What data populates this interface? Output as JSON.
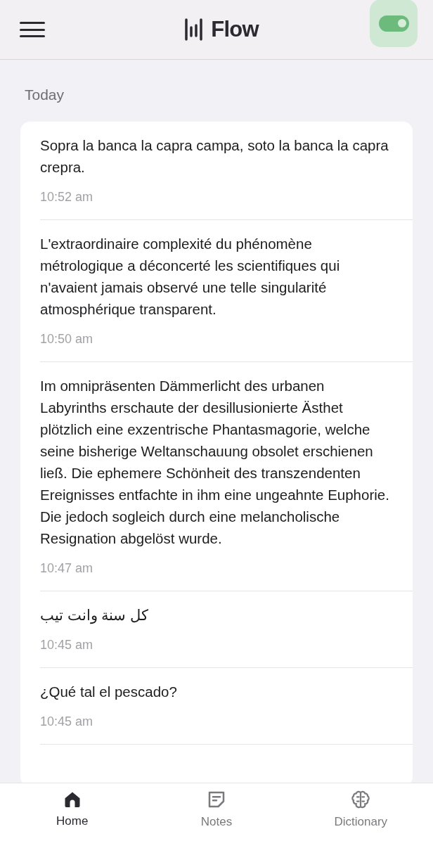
{
  "header": {
    "logo": "Flow",
    "toggle": {
      "on": true
    }
  },
  "section_title": "Today",
  "entries": [
    {
      "text": "Sopra la banca la capra campa, soto la banca la capra crepra.",
      "time": "10:52 am"
    },
    {
      "text": "L'extraordinaire complexité du phénomène métrologique a déconcerté les scientifiques qui n'avaient jamais observé une telle singularité atmosphérique transparent.",
      "time": "10:50 am"
    },
    {
      "text": "Im omnipräsenten Dämmerlicht des urbanen Labyrinths erschaute der desillusionierte Ästhet plötzlich eine exzentrische Phantasmagorie, welche seine bisherige Weltanschauung obsolet erschienen ließ. Die ephemere Schönheit des transzendenten Ereignisses entfachte in ihm eine ungeahnte Euphorie. Die jedoch sogleich durch eine melancholische Resignation abgelöst wurde.",
      "time": "10:47 am"
    },
    {
      "text": "كل سنة وانت تيب",
      "time": "10:45 am"
    },
    {
      "text": "¿Qué tal el pescado?",
      "time": "10:45 am"
    }
  ],
  "nav": [
    {
      "kind": "home",
      "label": "Home",
      "selected": true
    },
    {
      "kind": "notes",
      "label": "Notes",
      "selected": false
    },
    {
      "kind": "dictionary",
      "label": "Dictionary",
      "selected": false
    }
  ]
}
